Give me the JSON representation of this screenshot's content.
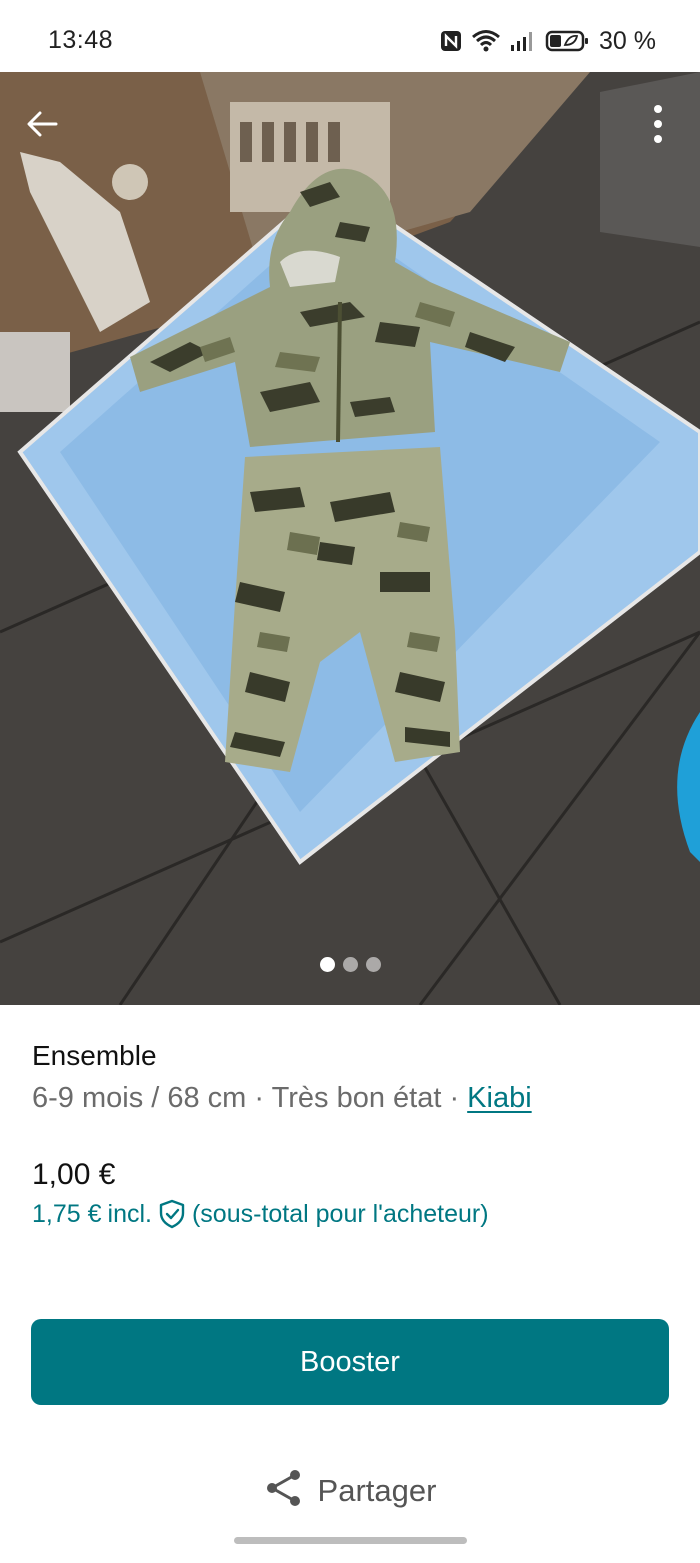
{
  "status_bar": {
    "time": "13:48",
    "battery": "30 %",
    "icons": [
      "nfc-icon",
      "wifi-icon",
      "signal-icon",
      "battery-icon"
    ]
  },
  "photo": {
    "icons": {
      "back": "arrow-left-icon",
      "menu": "more-vertical-icon"
    },
    "pager": {
      "count": 3,
      "active_index": 0
    }
  },
  "item": {
    "title": "Ensemble",
    "size": "6-9 mois / 68 cm",
    "separator": " · ",
    "condition": "Très bon état",
    "brand": "Kiabi",
    "price": "1,00 €",
    "price_with_fee": "1,75 €",
    "incl_label": "incl.",
    "subtotal_note": "(sous-total pour l'acheteur)"
  },
  "actions": {
    "booster_label": "Booster",
    "share_label": "Partager"
  },
  "colors": {
    "accent": "#007782",
    "text_primary": "#111111",
    "text_secondary": "#6b6b6b"
  }
}
